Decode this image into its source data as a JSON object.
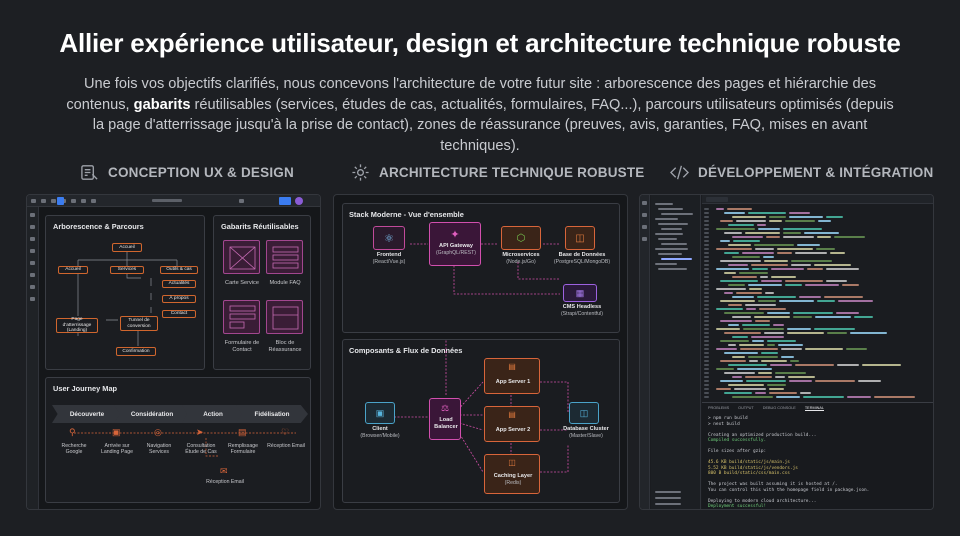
{
  "title": "Allier expérience utilisateur, design et architecture technique robuste",
  "intro": {
    "before": "Une fois vos objectifs clarifiés, nous concevons l'architecture de votre futur site : arborescence des pages et hiérarchie des contenus, ",
    "bold": "gabarits",
    "after": " réutilisables (services, études de cas, actualités, formulaires, FAQ...), parcours utilisateurs optimisés (depuis la page d'atterrissage jusqu'à la prise de contact), zones de réassurance (preuves, avis, garanties, FAQ, mises en avant techniques)."
  },
  "sections": {
    "ux": "CONCEPTION UX & DESIGN",
    "arch": "ARCHITECTURE TECHNIQUE ROBUSTE",
    "dev": "DÉVELOPPEMENT & INTÉGRATION"
  },
  "ux_panel": {
    "tree_title": "Arborescence & Parcours",
    "tree_nodes": {
      "accueil_top": "Accueil",
      "accueil": "Accueil",
      "services": "Services",
      "outils": "Outils & cas",
      "actualites": "Actualités",
      "apropos": "À propos",
      "contact": "Contact",
      "landing": "Page d'atterrissage (Landing)",
      "tunnel": "Tunnel de conversion",
      "confirmation": "Confirmation"
    },
    "gabarits_title": "Gabarits Réutilisables",
    "gabarits": [
      "Carte Service",
      "Module FAQ",
      "Formulaire de Contact",
      "Bloc de Réassurance"
    ],
    "journey_title": "User Journey Map",
    "stages": [
      "Découverte",
      "Considération",
      "Action",
      "Fidélisation"
    ],
    "steps": [
      "Recherche Google",
      "Arrivée sur Landing Page",
      "Navigation Services",
      "Consultation Étude de Cas",
      "Remplissage Formulaire",
      "Réception Email"
    ],
    "final_step": "Réception Email"
  },
  "arch_panel": {
    "stack_title": "Stack Moderne - Vue d'ensemble",
    "nodes": {
      "frontend": {
        "name": "Frontend",
        "sub": "(React/Vue.js)"
      },
      "gateway": {
        "name": "API Gateway",
        "sub": "(GraphQL/REST)"
      },
      "micro": {
        "name": "Microservices",
        "sub": "(Node.js/Go)"
      },
      "db": {
        "name": "Base de Données",
        "sub": "(PostgreSQL/MongoDB)"
      },
      "cms": {
        "name": "CMS Headless",
        "sub": "(Strapi/Contentful)"
      }
    },
    "flow_title": "Composants & Flux de Données",
    "flow": {
      "client": {
        "name": "Client",
        "sub": "(Browser/Mobile)"
      },
      "lb": {
        "name": "Load Balancer",
        "sub": ""
      },
      "app1": {
        "name": "App Server 1",
        "sub": ""
      },
      "app2": {
        "name": "App Server 2",
        "sub": ""
      },
      "cache": {
        "name": "Caching Layer",
        "sub": "(Redis)"
      },
      "cluster": {
        "name": "Database Cluster",
        "sub": "(Master/Slave)"
      }
    }
  },
  "dev_panel": {
    "tabs": [
      "PROBLEMS",
      "OUTPUT",
      "DEBUG CONSOLE",
      "TERMINAL"
    ],
    "terminal": [
      "> npm run build",
      "> next build",
      "",
      "Creating an optimized production build...",
      "Compiled successfully.",
      "",
      "File sizes after gzip:",
      "",
      "  45.6 KB  build/static/js/main.js",
      "  5.52 KB  build/static/js/vendors.js",
      "  800 B    build/static/css/main.css",
      "",
      "The project was built assuming it is hosted at /.",
      "You can control this with the homepage field in package.json.",
      "",
      "Deploying to modern cloud architecture...",
      "Deployment successful!"
    ]
  },
  "colors": {
    "accent_orange": "#d8653a",
    "accent_magenta": "#b14b9c",
    "background": "#1d1f23"
  }
}
